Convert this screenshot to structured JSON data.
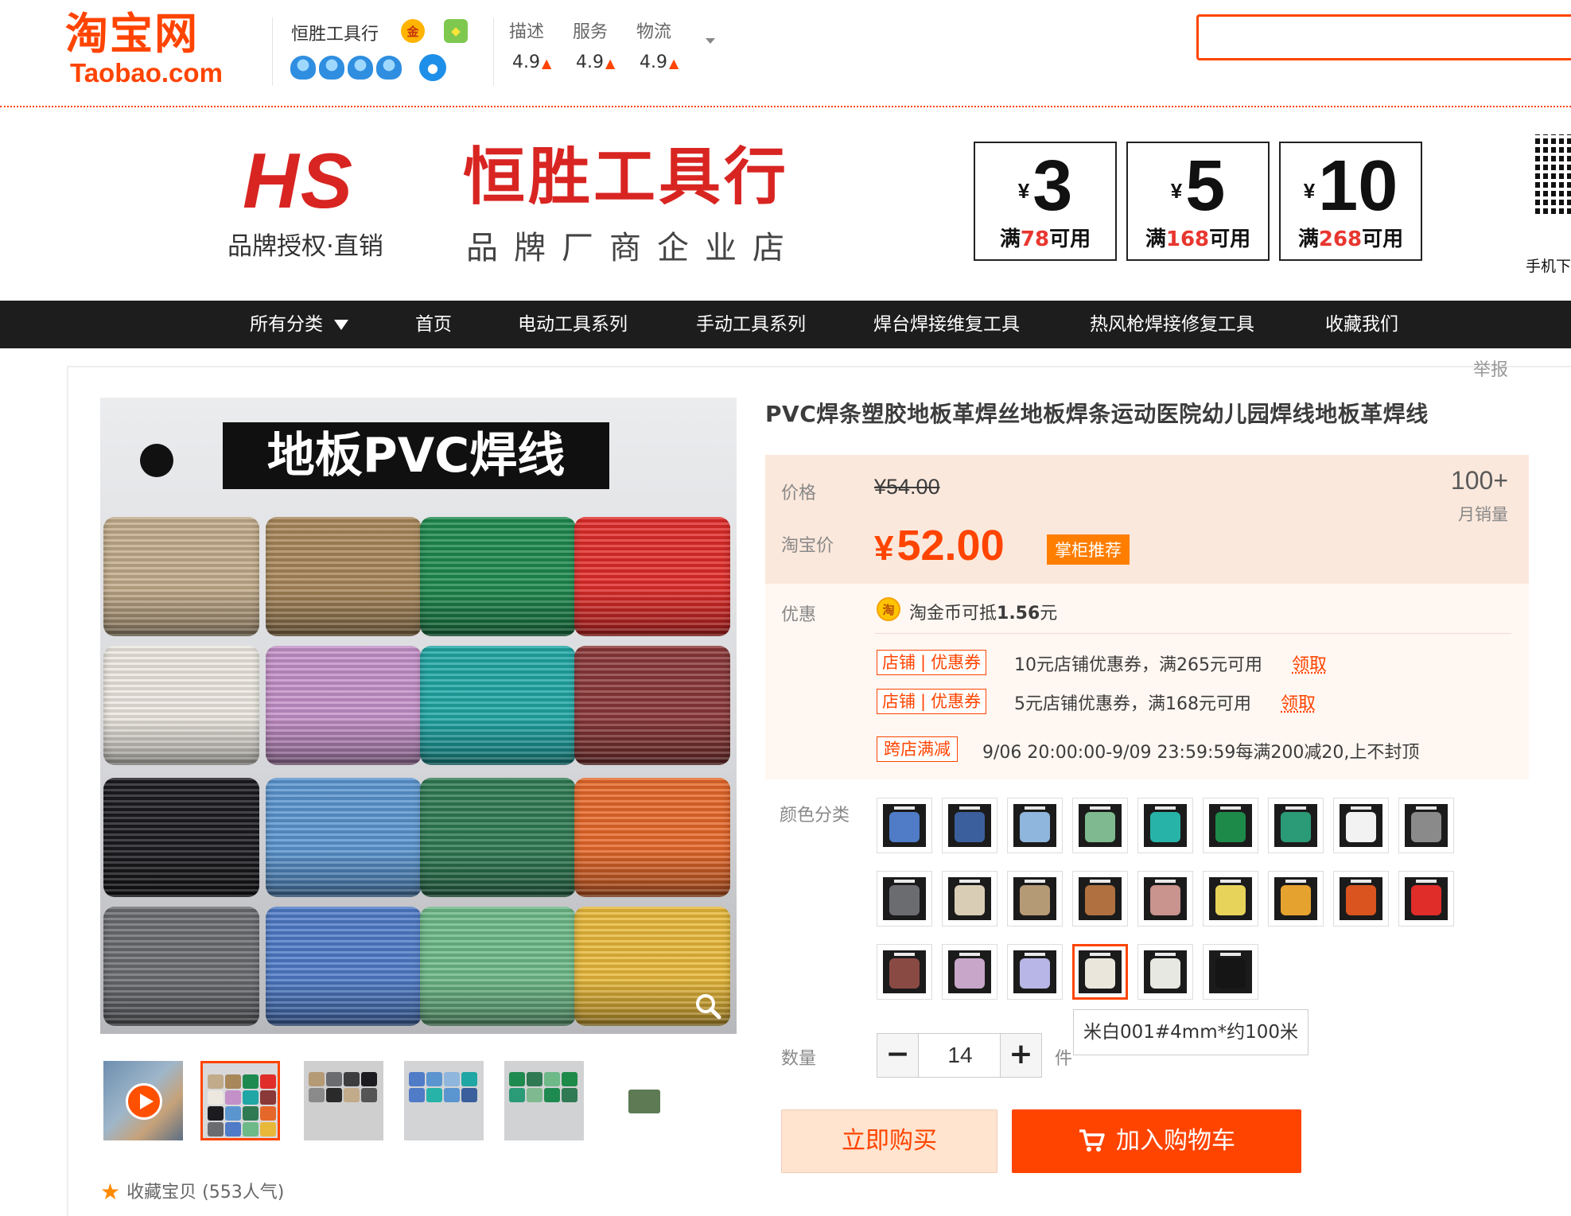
{
  "header": {
    "logo_cn": "淘宝网",
    "logo_en": "Taobao.com",
    "shop_name": "恒胜工具行",
    "gold_medal_icon": "金",
    "ratings": [
      {
        "label": "描述",
        "value": "4.9"
      },
      {
        "label": "服务",
        "value": "4.9"
      },
      {
        "label": "物流",
        "value": "4.9"
      }
    ],
    "search_placeholder": ""
  },
  "banner": {
    "logo_text": "HS",
    "logo_sub": "品牌授权·直销",
    "shop_title": "恒胜工具行",
    "shop_subtitle": "品牌厂商企业店",
    "coupons": [
      {
        "amount": "3",
        "cond_prefix": "满",
        "cond_num": "78",
        "cond_suffix": "可用"
      },
      {
        "amount": "5",
        "cond_prefix": "满",
        "cond_num": "168",
        "cond_suffix": "可用"
      },
      {
        "amount": "10",
        "cond_prefix": "满",
        "cond_num": "268",
        "cond_suffix": "可用"
      }
    ],
    "qr_label": "手机下",
    "yen": "¥"
  },
  "nav": {
    "items": [
      "所有分类",
      "首页",
      "电动工具系列",
      "手动工具系列",
      "焊台焊接维复工具",
      "热风枪焊接修复工具",
      "收藏我们"
    ]
  },
  "report": "举报",
  "main_image": {
    "title": "地板PVC焊线",
    "spool_colors": [
      [
        "#c2ab8a",
        "#a8875a",
        "#1f8a4f",
        "#e02d2a"
      ],
      [
        "#ece8e0",
        "#c490c8",
        "#20a6a4",
        "#8a3838"
      ],
      [
        "#1c1c20",
        "#5b95d0",
        "#2f7a53",
        "#e5682a"
      ],
      [
        "#6a6c70",
        "#4f7bc7",
        "#6db988",
        "#e7b83a"
      ]
    ]
  },
  "thumbnails": [
    "video",
    "main",
    "dark",
    "blue",
    "green",
    "spool"
  ],
  "favorite": {
    "label": "收藏宝贝",
    "count": "(553人气)"
  },
  "item": {
    "title": "PVC焊条塑胶地板革焊丝地板焊条运动医院幼儿园焊线地板革焊线",
    "price_label": "价格",
    "orig_price": "¥54.00",
    "taobao_price_label": "淘宝价",
    "sale_yen": "¥",
    "sale_price": "52.00",
    "recommend": "掌柜推荐",
    "monthly_sales": "100+",
    "monthly_sales_label": "月销量",
    "promo_label": "优惠",
    "coin_icon": "淘",
    "coin_text_prefix": "淘金币可抵",
    "coin_amount": "1.56",
    "coin_text_suffix": "元",
    "coupons": [
      {
        "tag_a": "店铺",
        "tag_b": "优惠券",
        "text": "10元店铺优惠券，满265元可用",
        "link": "领取"
      },
      {
        "tag_a": "店铺",
        "tag_b": "优惠券",
        "text": "5元店铺优惠券，满168元可用",
        "link": "领取"
      }
    ],
    "cross_store_tag": "跨店满减",
    "cross_store_text": "9/06 20:00:00-9/09 23:59:59每满200减20,上不封顶",
    "color_label": "颜色分类",
    "swatches": [
      "#4f7bc7",
      "#3a5f9c",
      "#8fb6dd",
      "#7fb98f",
      "#27b3a8",
      "#1e8a4a",
      "#2a9a77",
      "#f2f2f2",
      "#8a8a8a",
      "#6a6c70",
      "#d9cdb5",
      "#b59a76",
      "#b07040",
      "#c9938e",
      "#e8d35a",
      "#e6a22e",
      "#d9541f",
      "#e02d2a",
      "#8a4a44",
      "#c7a6c9",
      "#b8b6e6",
      "#eae6dc",
      "#e8e8e2",
      "#151515"
    ],
    "selected_swatch": 21,
    "tooltip": "米白001#4mm*约100米",
    "qty_label": "数量",
    "qty_minus": "−",
    "qty_value": "14",
    "qty_plus": "+",
    "qty_unit": "件",
    "buy_now": "立即购买",
    "add_cart": "加入购物车"
  },
  "colors": {
    "accent": "#ff4400",
    "nav_bg": "#1d1d1d",
    "price_bg": "#fbe8dc"
  }
}
